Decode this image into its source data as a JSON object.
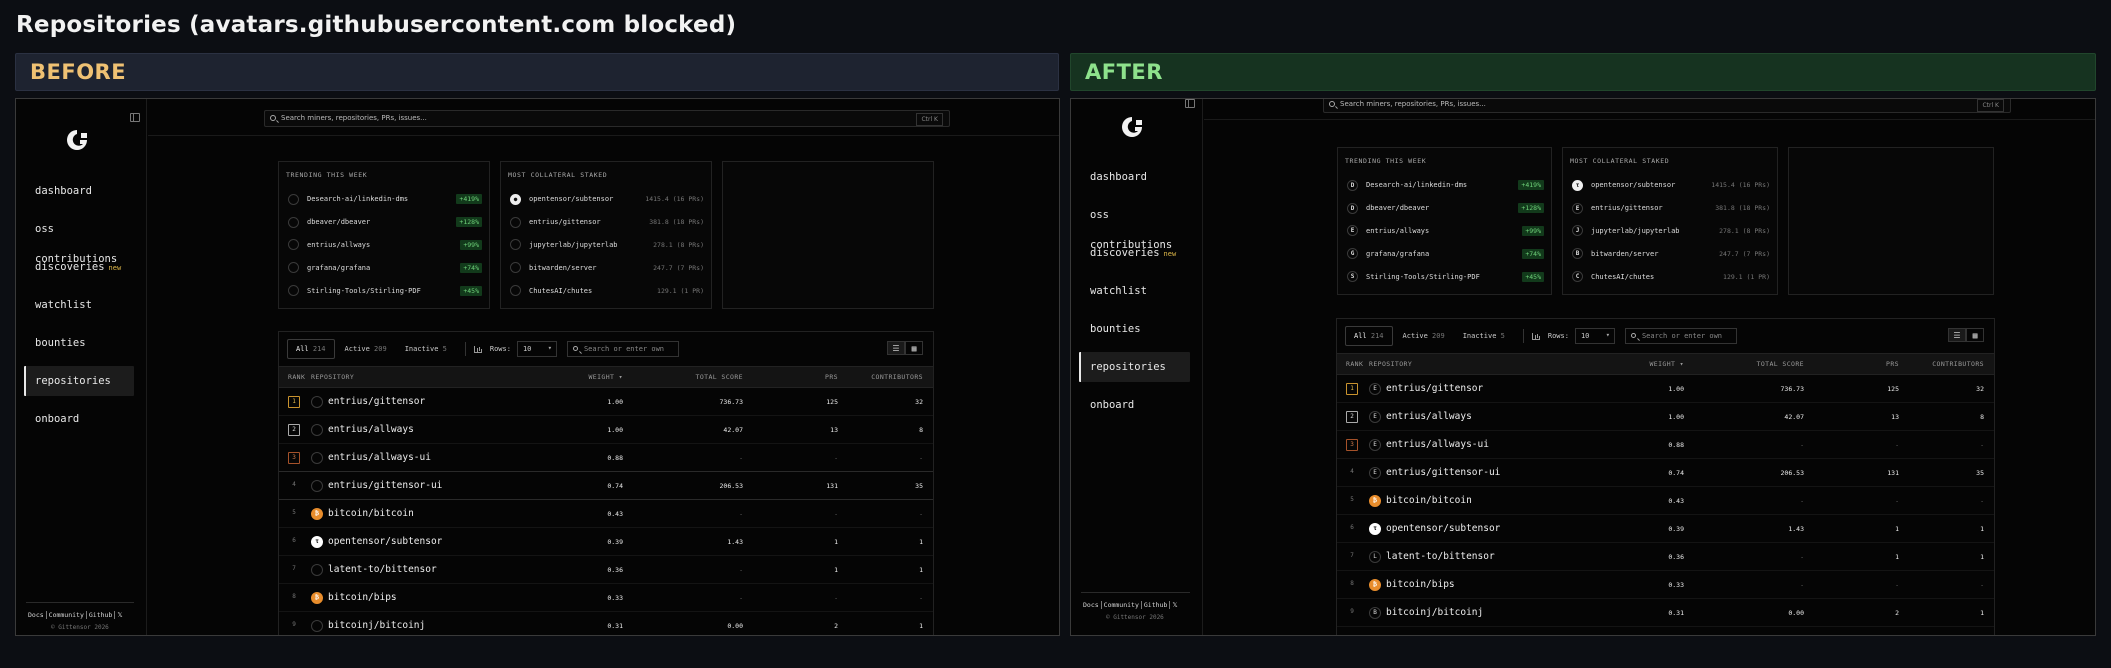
{
  "page_title": "Repositories (avatars.githubusercontent.com blocked)",
  "before_label": "BEFORE",
  "after_label": "AFTER",
  "nav": [
    {
      "label": "dashboard"
    },
    {
      "label": "oss contributions"
    },
    {
      "label": "discoveries",
      "tag": "new"
    },
    {
      "label": "watchlist"
    },
    {
      "label": "bounties"
    },
    {
      "label": "repositories",
      "active": true
    },
    {
      "label": "onboard"
    }
  ],
  "footer": {
    "links": [
      "Docs",
      "Community",
      "Github",
      "𝕏"
    ],
    "copyright": "© Gittensor 2026"
  },
  "search": {
    "placeholder": "Search miners, repositories, PRs, issues...",
    "shortcut": "Ctrl K"
  },
  "trending": {
    "title": "TRENDING THIS WEEK",
    "items": [
      {
        "name": "Desearch-ai/linkedin-dms",
        "change": "+419%",
        "initial": "D"
      },
      {
        "name": "dbeaver/dbeaver",
        "change": "+128%",
        "initial": "D"
      },
      {
        "name": "entrius/allways",
        "change": "+99%",
        "initial": "E"
      },
      {
        "name": "grafana/grafana",
        "change": "+74%",
        "initial": "G"
      },
      {
        "name": "Stirling-Tools/Stirling-PDF",
        "change": "+45%",
        "initial": "S"
      }
    ]
  },
  "collateral": {
    "title": "MOST COLLATERAL STAKED",
    "items": [
      {
        "name": "opentensor/subtensor",
        "stake": "1415.4 (16 PRs)",
        "initial": "τ"
      },
      {
        "name": "entrius/gittensor",
        "stake": "381.8 (18 PRs)",
        "initial": "E"
      },
      {
        "name": "jupyterlab/jupyterlab",
        "stake": "278.1 (8 PRs)",
        "initial": "J"
      },
      {
        "name": "bitwarden/server",
        "stake": "247.7 (7 PRs)",
        "initial": "B"
      },
      {
        "name": "ChutesAI/chutes",
        "stake": "129.1 (1 PR)",
        "initial": "C"
      }
    ]
  },
  "filters": {
    "all": "All",
    "all_count": "214",
    "active": "Active",
    "active_count": "209",
    "inactive": "Inactive",
    "inactive_count": "5",
    "rows_label": "Rows:",
    "rows_value": "10",
    "search_placeholder": "Search or enter own"
  },
  "table": {
    "columns": [
      "RANK",
      "REPOSITORY",
      "WEIGHT ▾",
      "TOTAL SCORE",
      "PRS",
      "CONTRIBUTORS"
    ],
    "rows": [
      {
        "rank": "1",
        "name": "entrius/gittensor",
        "weight": "1.00",
        "score": "736.73",
        "prs": "125",
        "contributors": "32",
        "initial": "E"
      },
      {
        "rank": "2",
        "name": "entrius/allways",
        "weight": "1.00",
        "score": "42.07",
        "prs": "13",
        "contributors": "8",
        "initial": "E"
      },
      {
        "rank": "3",
        "name": "entrius/allways-ui",
        "weight": "0.88",
        "score": "-",
        "prs": "-",
        "contributors": "-",
        "initial": "E"
      },
      {
        "rank": "4",
        "name": "entrius/gittensor-ui",
        "weight": "0.74",
        "score": "206.53",
        "prs": "131",
        "contributors": "35",
        "initial": "E"
      },
      {
        "rank": "5",
        "name": "bitcoin/bitcoin",
        "weight": "0.43",
        "score": "-",
        "prs": "-",
        "contributors": "-",
        "initial": "B"
      },
      {
        "rank": "6",
        "name": "opentensor/subtensor",
        "weight": "0.39",
        "score": "1.43",
        "prs": "1",
        "contributors": "1",
        "initial": "τ"
      },
      {
        "rank": "7",
        "name": "latent-to/bittensor",
        "weight": "0.36",
        "score": "-",
        "prs": "1",
        "contributors": "1",
        "initial": "L"
      },
      {
        "rank": "8",
        "name": "bitcoin/bips",
        "weight": "0.33",
        "score": "-",
        "prs": "-",
        "contributors": "-",
        "initial": "B"
      },
      {
        "rank": "9",
        "name": "bitcoinj/bitcoinj",
        "weight": "0.31",
        "score": "0.00",
        "prs": "2",
        "contributors": "1",
        "initial": "B"
      }
    ]
  }
}
